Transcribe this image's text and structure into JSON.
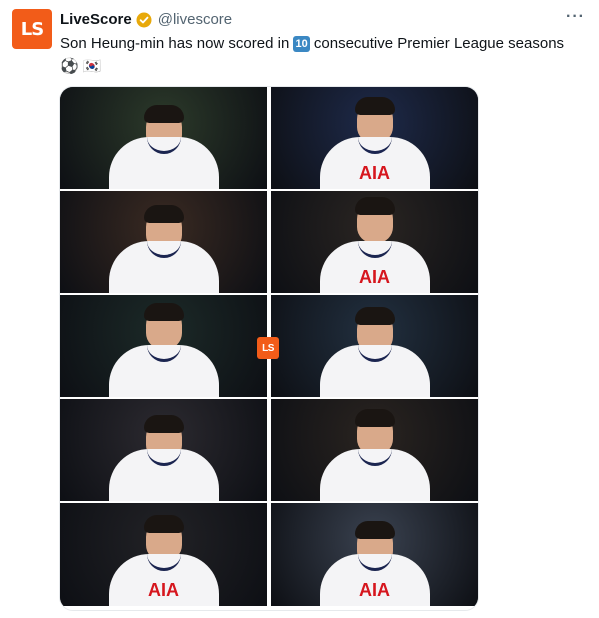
{
  "tweet": {
    "avatar_text": "LS",
    "display_name": "LiveScore",
    "handle": "@livescore",
    "more_label": "···",
    "text_before": "Son Heung-min has now scored in ",
    "number_badge": "10",
    "text_after": " consecutive Premier League seasons",
    "emojis": "⚽ 🇰🇷"
  },
  "media": {
    "overlay_logo": "LS",
    "sponsor_text": "AIA",
    "tiles": [
      {
        "name": "photo-1",
        "bg": "#2c3a2a"
      },
      {
        "name": "photo-2",
        "bg": "#1e2a4a"
      },
      {
        "name": "photo-3",
        "bg": "#3a2a22"
      },
      {
        "name": "photo-4",
        "bg": "#2a2522"
      },
      {
        "name": "photo-5",
        "bg": "#1c2a28"
      },
      {
        "name": "photo-6",
        "bg": "#223040"
      },
      {
        "name": "photo-7",
        "bg": "#2c2a30"
      },
      {
        "name": "photo-8",
        "bg": "#2a2420"
      },
      {
        "name": "photo-9",
        "bg": "#222226"
      },
      {
        "name": "photo-10",
        "bg": "#3a4250"
      }
    ]
  },
  "colors": {
    "brand": "#f25c19",
    "verified": "#f4b400",
    "text": "#0f1419",
    "secondary": "#536471"
  }
}
